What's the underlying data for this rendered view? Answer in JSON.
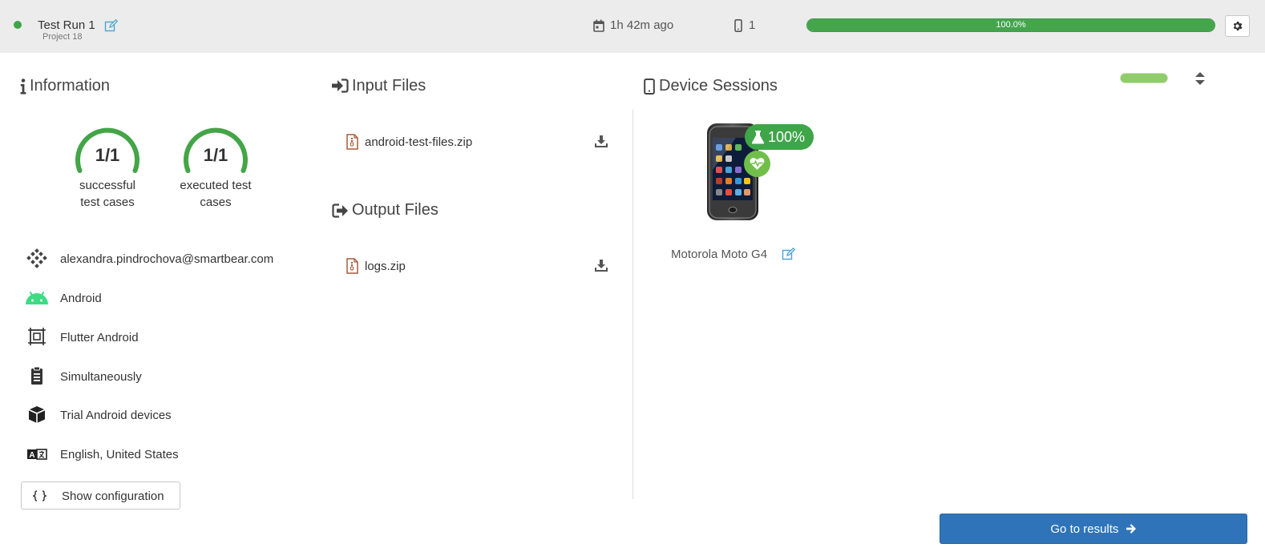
{
  "header": {
    "run_title": "Test Run 1",
    "project_name": "Project 18",
    "time_ago": "1h 42m ago",
    "device_count": "1",
    "progress_label": "100.0%",
    "progress_fraction": 1.0,
    "status_color": "#3ea548"
  },
  "information": {
    "title": "Information",
    "gauges": [
      {
        "value": "1/1",
        "label_line1": "successful",
        "label_line2": "test cases"
      },
      {
        "value": "1/1",
        "label_line1": "executed test",
        "label_line2": "cases"
      }
    ],
    "items": [
      {
        "icon": "user-avatar-icon",
        "text": "alexandra.pindrochova@smartbear.com"
      },
      {
        "icon": "android-icon",
        "text": "Android"
      },
      {
        "icon": "framework-icon",
        "text": "Flutter Android"
      },
      {
        "icon": "clipboard-icon",
        "text": "Simultaneously"
      },
      {
        "icon": "cube-icon",
        "text": "Trial Android devices"
      },
      {
        "icon": "language-icon",
        "text": "English, United States"
      }
    ],
    "config_button": "Show configuration"
  },
  "input_files": {
    "title": "Input Files",
    "files": [
      {
        "name": "android-test-files.zip"
      }
    ]
  },
  "output_files": {
    "title": "Output Files",
    "files": [
      {
        "name": "logs.zip"
      }
    ]
  },
  "device_sessions": {
    "title": "Device Sessions",
    "device": {
      "name": "Motorola Moto G4",
      "success_rate": "100%"
    }
  },
  "footer": {
    "results_button": "Go to results"
  },
  "colors": {
    "accent_green": "#3ea548",
    "button_blue": "#2f74b8",
    "android_green": "#3ddc84"
  }
}
